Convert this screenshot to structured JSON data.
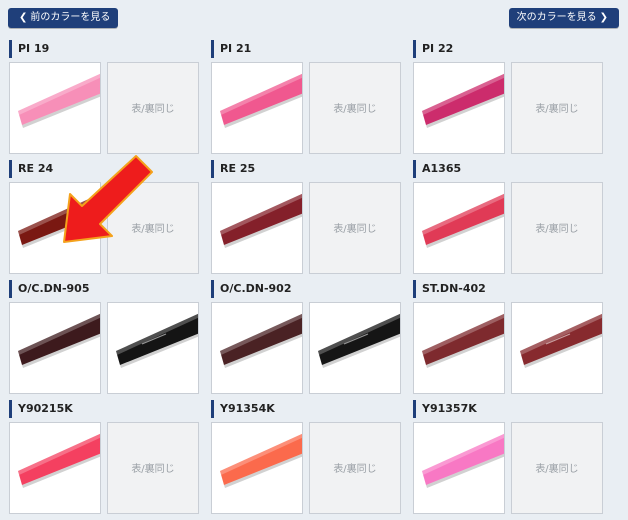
{
  "nav": {
    "prev_label": "前のカラーを見る",
    "next_label": "次のカラーを見る"
  },
  "same_text": "表/裏同じ",
  "items": [
    {
      "code": "PI 19",
      "front": "#f78fb8",
      "back": null
    },
    {
      "code": "PI 21",
      "front": "#f0588f",
      "back": null
    },
    {
      "code": "PI 22",
      "front": "#cc2c6c",
      "back": null
    },
    {
      "code": "RE 24",
      "front": "#7a1812",
      "back": null
    },
    {
      "code": "RE 25",
      "front": "#84202a",
      "back": null
    },
    {
      "code": "A1365",
      "front": "#e03a56",
      "back": null
    },
    {
      "code": "O/C.DN-905",
      "front": "#3d1a1d",
      "back": "#141414"
    },
    {
      "code": "O/C.DN-902",
      "front": "#4a2224",
      "back": "#151515"
    },
    {
      "code": "ST.DN-402",
      "front": "#7e2a2e",
      "back": "#872a2e"
    },
    {
      "code": "Y90215K",
      "front": "#f44060",
      "back": null
    },
    {
      "code": "Y91354K",
      "front": "#fb6a4c",
      "back": null
    },
    {
      "code": "Y91357K",
      "front": "#f878c4",
      "back": null
    }
  ],
  "annotation": {
    "color": "#ee1c1c",
    "outline": "#f4a21c"
  }
}
